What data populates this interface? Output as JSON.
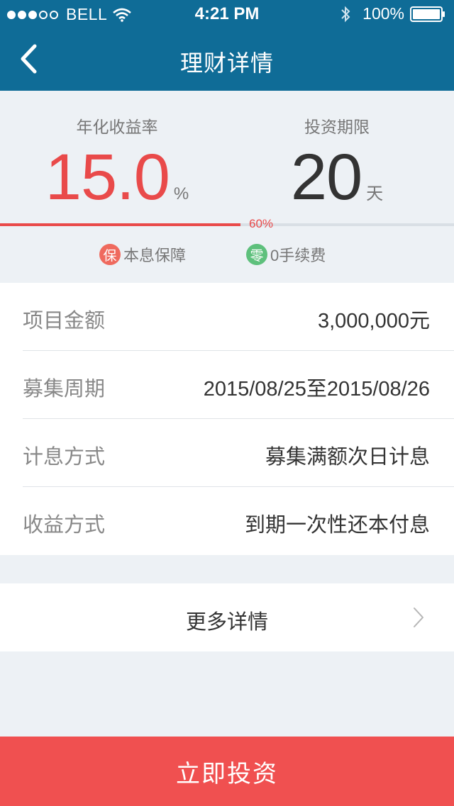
{
  "status_bar": {
    "carrier": "BELL",
    "time": "4:21 PM",
    "battery": "100%",
    "signal_bars_filled": 3,
    "signal_bars_total": 5
  },
  "nav": {
    "title": "理财详情",
    "back_icon": "chevron-left-icon"
  },
  "summary": {
    "rate_label": "年化收益率",
    "rate_value": "15.0",
    "rate_unit": "%",
    "term_label": "投资期限",
    "term_value": "20",
    "term_unit": "天",
    "progress_percent": 60,
    "progress_label": "60%",
    "features": [
      {
        "badge": "保",
        "label": "本息保障",
        "color": "#ef6a5e"
      },
      {
        "badge": "零",
        "label": "0手续费",
        "color": "#5ec07c"
      }
    ]
  },
  "details": [
    {
      "label": "项目金额",
      "value": "3,000,000元"
    },
    {
      "label": "募集周期",
      "value": "2015/08/25至2015/08/26"
    },
    {
      "label": "计息方式",
      "value": "募集满额次日计息"
    },
    {
      "label": "收益方式",
      "value": "到期一次性还本付息"
    }
  ],
  "more": {
    "label": "更多详情"
  },
  "action": {
    "invest_label": "立即投资"
  },
  "colors": {
    "header": "#0f6c97",
    "accent_red": "#e94a4a",
    "button": "#f05050",
    "background": "#edf1f5"
  }
}
